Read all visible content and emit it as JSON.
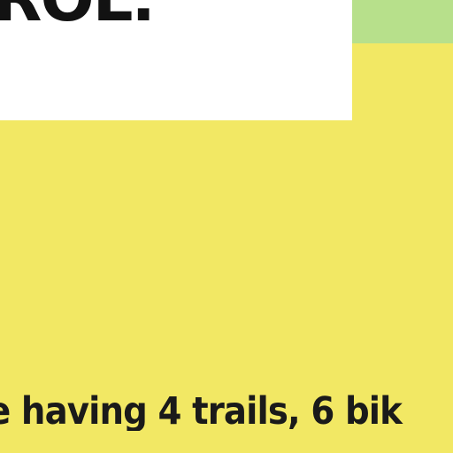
{
  "hero": {
    "headline_fragment": "ROL."
  },
  "story": {
    "line_fragment": "e having 4 trails, 6 bik"
  }
}
